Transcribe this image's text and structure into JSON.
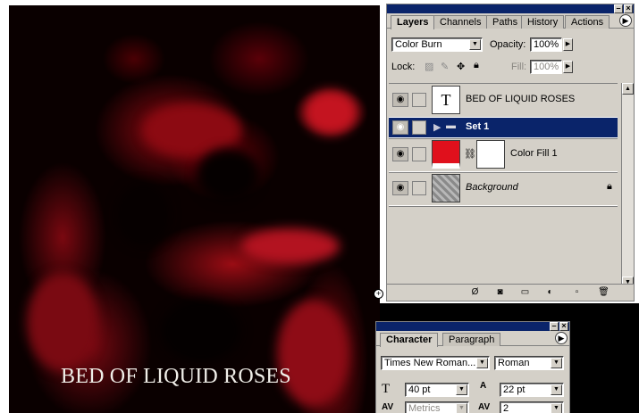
{
  "canvas": {
    "text": "BED OF LIQUID ROSES"
  },
  "layers_panel": {
    "tabs": [
      "Layers",
      "Channels",
      "Paths",
      "History",
      "Actions"
    ],
    "blend_mode": "Color Burn",
    "opacity_label": "Opacity:",
    "opacity_value": "100%",
    "lock_label": "Lock:",
    "fill_label": "Fill:",
    "fill_value": "100%",
    "layers": [
      {
        "name": "BED OF LIQUID ROSES",
        "thumb": "T"
      },
      {
        "name": "Set 1"
      },
      {
        "name": "Color Fill 1"
      },
      {
        "name": "Background"
      }
    ]
  },
  "character_panel": {
    "tabs": [
      "Character",
      "Paragraph"
    ],
    "font_family": "Times New Roman...",
    "font_style": "Roman",
    "font_size": "40 pt",
    "leading": "22 pt",
    "kerning": "Metrics",
    "tracking": "2"
  },
  "colors": {
    "selected_row": "#0a246a",
    "panel_bg": "#d4d0c8",
    "fill_swatch": "#e0101c"
  },
  "icons": {
    "visibility": "eye-icon",
    "folder": "folder-icon",
    "lock": "lock-icon",
    "link": "chain-link-icon"
  }
}
